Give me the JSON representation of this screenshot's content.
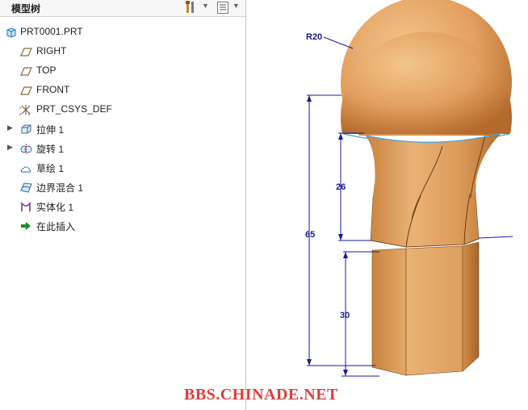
{
  "tree": {
    "title": "模型树",
    "toolbar_icons": [
      "settings-tools-icon",
      "dropdown-caret-icon",
      "list-options-icon",
      "dropdown-caret-icon"
    ],
    "root": {
      "label": "PRT0001.PRT",
      "icon": "part-icon"
    },
    "items": [
      {
        "label": "RIGHT",
        "icon": "datum-plane-icon",
        "expandable": false
      },
      {
        "label": "TOP",
        "icon": "datum-plane-icon",
        "expandable": false
      },
      {
        "label": "FRONT",
        "icon": "datum-plane-icon",
        "expandable": false
      },
      {
        "label": "PRT_CSYS_DEF",
        "icon": "coordinate-system-icon",
        "expandable": false
      },
      {
        "label": "拉伸 1",
        "icon": "extrude-icon",
        "expandable": true
      },
      {
        "label": "旋转 1",
        "icon": "revolve-icon",
        "expandable": true
      },
      {
        "label": "草绘 1",
        "icon": "sketch-icon",
        "expandable": false
      },
      {
        "label": "边界混合 1",
        "icon": "boundary-blend-icon",
        "expandable": false
      },
      {
        "label": "实体化 1",
        "icon": "solidify-icon",
        "expandable": false
      },
      {
        "label": "在此插入",
        "icon": "insert-here-arrow-icon",
        "expandable": false
      }
    ]
  },
  "model": {
    "dimensions": [
      {
        "name": "sphere-radius",
        "text": "R20"
      },
      {
        "name": "neck-height",
        "text": "26"
      },
      {
        "name": "total-height",
        "text": "65"
      },
      {
        "name": "base-height",
        "text": "30"
      }
    ],
    "colors": {
      "wood_light": "#e8a865",
      "wood_dark": "#b0702e",
      "dimension": "#1a1a9a",
      "edge_highlight": "#3aa8d8"
    }
  },
  "watermark": "BBS.CHINADE.NET"
}
